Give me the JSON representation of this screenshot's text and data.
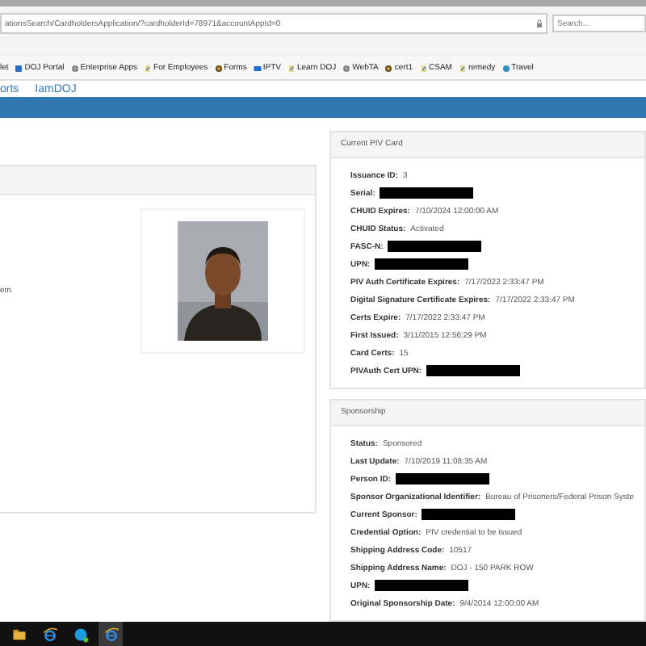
{
  "browser": {
    "address": "ationsSearch/CardholdersApplication/?cardholderId=78971&accountAppId=0",
    "search": {
      "placeholder": "Search..."
    },
    "favorites": [
      {
        "label": "let"
      },
      {
        "label": "DOJ Portal",
        "kind": "portal"
      },
      {
        "label": "Enterprise Apps",
        "kind": "globe"
      },
      {
        "label": "For Employees",
        "kind": "page"
      },
      {
        "label": "Forms",
        "kind": "seal"
      },
      {
        "label": "IPTV",
        "kind": "screen"
      },
      {
        "label": "Learn DOJ",
        "kind": "page"
      },
      {
        "label": "WebTA",
        "kind": "globe"
      },
      {
        "label": "cert1",
        "kind": "seal"
      },
      {
        "label": "CSAM",
        "kind": "page"
      },
      {
        "label": "remedy",
        "kind": "page"
      },
      {
        "label": "Travel",
        "kind": "earth"
      }
    ]
  },
  "nav": [
    "orts",
    "IamDOJ"
  ],
  "left_panel": {
    "fragment": "em"
  },
  "piv_card": {
    "title": "Current PIV Card",
    "fields": [
      {
        "label": "Issuance ID:",
        "value": "3"
      },
      {
        "label": "Serial:",
        "redacted": true
      },
      {
        "label": "CHUID Expires:",
        "value": "7/10/2024 12:00:00 AM"
      },
      {
        "label": "CHUID Status:",
        "value": "Activated"
      },
      {
        "label": "FASC-N:",
        "redacted": true
      },
      {
        "label": "UPN:",
        "redacted": true
      },
      {
        "label": "PIV Auth Certificate Expires:",
        "value": "7/17/2022 2:33:47 PM"
      },
      {
        "label": "Digital Signature Certificate Expires:",
        "value": "7/17/2022 2:33:47 PM"
      },
      {
        "label": "Certs Expire:",
        "value": "7/17/2022 2:33:47 PM"
      },
      {
        "label": "First Issued:",
        "value": "3/11/2015 12:56:29 PM"
      },
      {
        "label": "Card Certs:",
        "value": "15"
      },
      {
        "label": "PIVAuth Cert UPN:",
        "redacted": true
      }
    ]
  },
  "sponsorship": {
    "title": "Sponsorship",
    "fields": [
      {
        "label": "Status:",
        "value": "Sponsored"
      },
      {
        "label": "Last Update:",
        "value": "7/10/2019 11:08:35 AM"
      },
      {
        "label": "Person ID:",
        "redacted": true
      },
      {
        "label": "Sponsor Organizational Identifier:",
        "value": "Bureau of Prisoners/Federal Prison Syste"
      },
      {
        "label": "Current Sponsor:",
        "redacted": true
      },
      {
        "label": "Credential Option:",
        "value": "PIV credential to be issued"
      },
      {
        "label": "Shipping Address Code:",
        "value": "10517"
      },
      {
        "label": "Shipping Address Name:",
        "value": "DOJ - 150 PARK ROW"
      },
      {
        "label": "UPN:",
        "redacted": true
      },
      {
        "label": "Original Sponsorship Date:",
        "value": "9/4/2014 12:00:00 AM"
      }
    ]
  },
  "taskbar": [
    {
      "kind": "folder",
      "selected": false
    },
    {
      "kind": "browser",
      "selected": false
    },
    {
      "kind": "chat",
      "selected": false
    },
    {
      "kind": "browser",
      "selected": true
    }
  ]
}
